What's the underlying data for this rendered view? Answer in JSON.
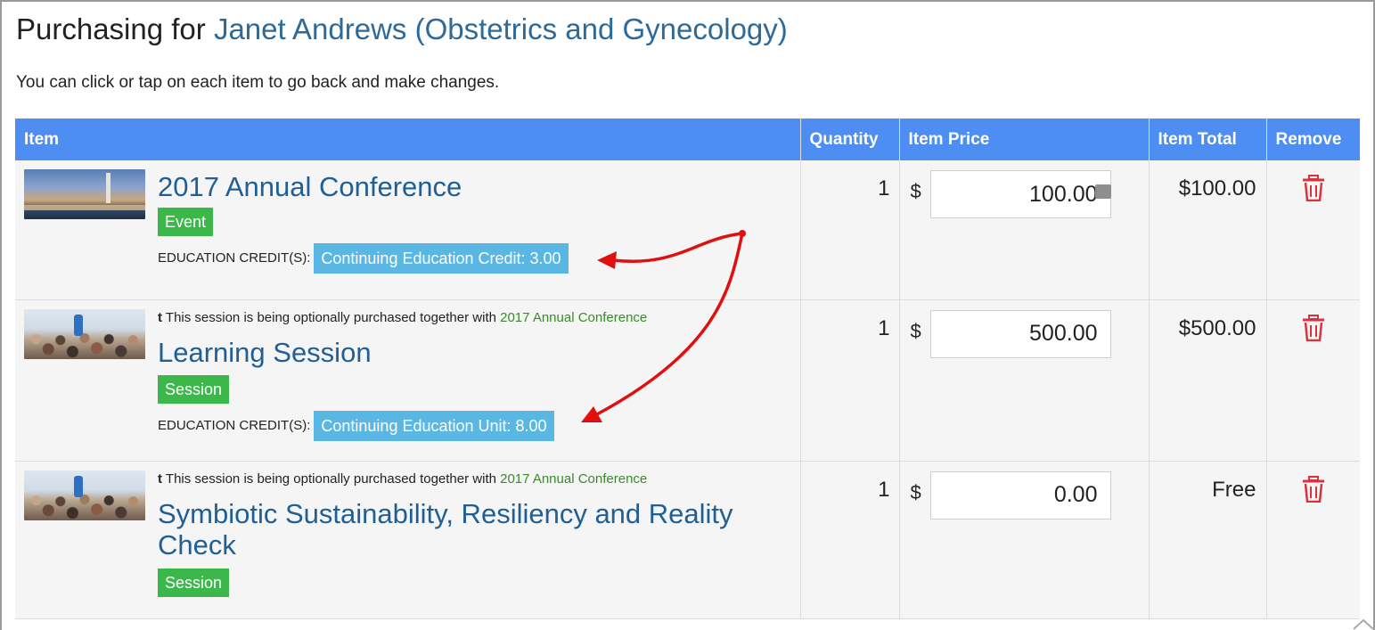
{
  "header": {
    "title_prefix": "Purchasing for",
    "customer": "Janet Andrews (Obstetrics and Gynecology)",
    "subtitle": "You can click or tap on each item to go back and make changes."
  },
  "table": {
    "columns": [
      "Item",
      "Quantity",
      "Item Price",
      "Item Total",
      "Remove"
    ],
    "currency_symbol": "$",
    "credits_label": "EDUCATION CREDIT(S):",
    "rows": [
      {
        "name": "2017 Annual Conference",
        "type": "Event",
        "credit": "Continuing Education Credit: 3.00",
        "quantity": "1",
        "price": "100.00",
        "total": "$100.00"
      },
      {
        "note_icon": "t",
        "note": "This session is being optionally purchased together with",
        "note_link": "2017 Annual Conference",
        "name": "Learning Session",
        "type": "Session",
        "credit": "Continuing Education Unit: 8.00",
        "quantity": "1",
        "price": "500.00",
        "total": "$500.00"
      },
      {
        "note_icon": "t",
        "note": "This session is being optionally purchased together with",
        "note_link": "2017 Annual Conference",
        "name": "Symbiotic Sustainability, Resiliency and Reality Check",
        "type": "Session",
        "quantity": "1",
        "price": "0.00",
        "total": "Free"
      }
    ]
  },
  "colors": {
    "header_bg": "#4e8ef2",
    "item_link": "#1f5f95",
    "badge_green": "#3cb84a",
    "badge_blue": "#5ab7e3",
    "trash": "#d9333f",
    "annotation_arrow": "#e01010"
  },
  "icons": {
    "remove": "trash-icon",
    "annotation": "red-arrow-icon"
  }
}
